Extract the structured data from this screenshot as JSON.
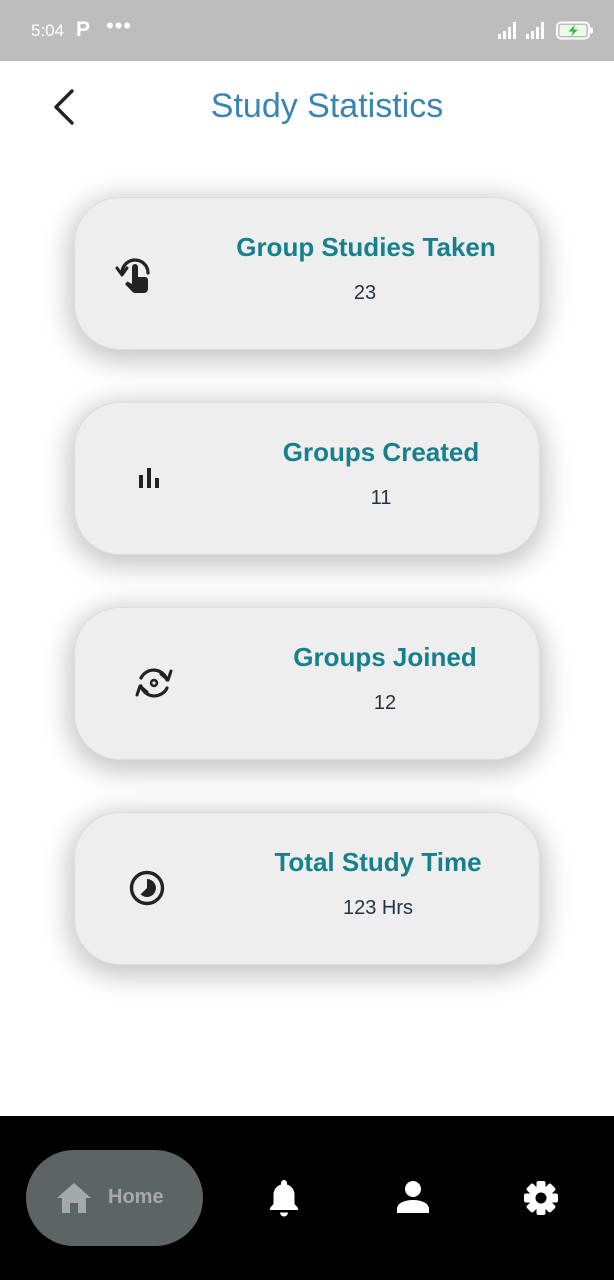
{
  "status_bar": {
    "time": "5:04",
    "app_indicator": "P",
    "more": "•••",
    "icons": [
      "signal-icon",
      "signal-icon",
      "battery-charging-icon"
    ]
  },
  "header": {
    "back_icon": "chevron-left-icon",
    "title": "Study Statistics",
    "title_color": "#3a84b4"
  },
  "stats": [
    {
      "icon": "touch-rotate-icon",
      "title": "Group Studies Taken",
      "value": "23"
    },
    {
      "icon": "bar-chart-icon",
      "title": "Groups Created",
      "value": "11"
    },
    {
      "icon": "sync-eye-icon",
      "title": "Groups Joined",
      "value": "12"
    },
    {
      "icon": "timelapse-icon",
      "title": "Total Study Time",
      "value": "123 Hrs"
    }
  ],
  "colors": {
    "card_title": "#17808d",
    "card_value": "#1f3344",
    "card_background": "#eeeeee",
    "nav_background": "#000000",
    "nav_active_pill": "#5d6466"
  },
  "bottom_nav": {
    "home_label": "Home",
    "items": [
      "home-icon",
      "bell-icon",
      "person-icon",
      "settings-icon"
    ]
  }
}
